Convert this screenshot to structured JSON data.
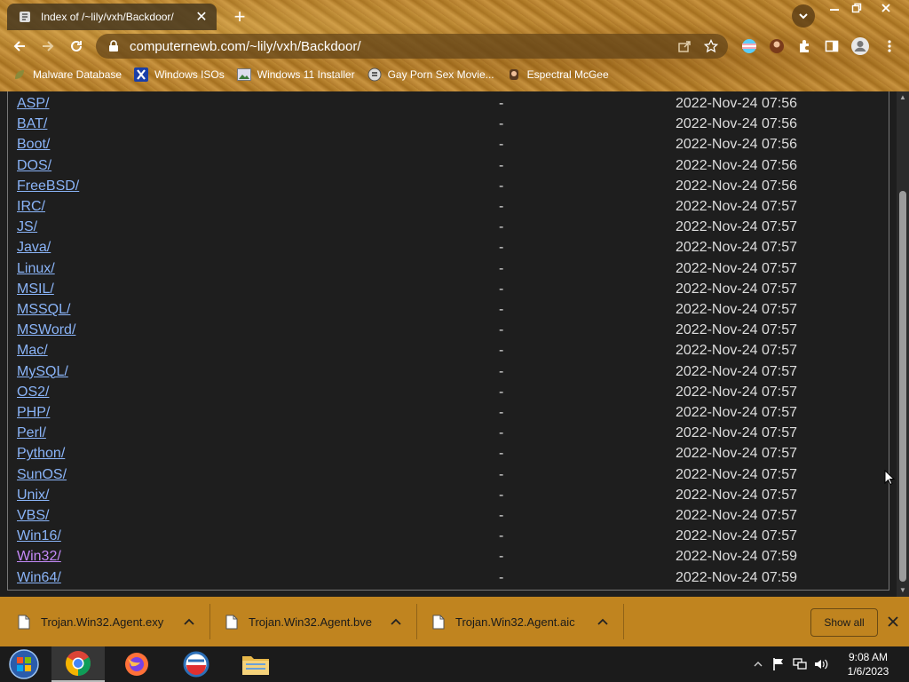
{
  "browser": {
    "tab": {
      "title": "Index of /~lily/vxh/Backdoor/"
    },
    "address": {
      "url": "computernewb.com/~lily/vxh/Backdoor/"
    },
    "bookmarks": [
      {
        "label": "Malware Database",
        "icon": "leaf-icon"
      },
      {
        "label": "Windows ISOs",
        "icon": "x-logo-icon"
      },
      {
        "label": "Windows 11 Installer",
        "icon": "image-icon"
      },
      {
        "label": "Gay Porn Sex Movie...",
        "icon": "badge-icon"
      },
      {
        "label": "Espectral McGee",
        "icon": "character-icon"
      }
    ]
  },
  "listing": {
    "rows": [
      {
        "name": "ASP/",
        "size": "-",
        "date": "2022-Nov-24 07:56"
      },
      {
        "name": "BAT/",
        "size": "-",
        "date": "2022-Nov-24 07:56"
      },
      {
        "name": "Boot/",
        "size": "-",
        "date": "2022-Nov-24 07:56"
      },
      {
        "name": "DOS/",
        "size": "-",
        "date": "2022-Nov-24 07:56"
      },
      {
        "name": "FreeBSD/",
        "size": "-",
        "date": "2022-Nov-24 07:56"
      },
      {
        "name": "IRC/",
        "size": "-",
        "date": "2022-Nov-24 07:57"
      },
      {
        "name": "JS/",
        "size": "-",
        "date": "2022-Nov-24 07:57"
      },
      {
        "name": "Java/",
        "size": "-",
        "date": "2022-Nov-24 07:57"
      },
      {
        "name": "Linux/",
        "size": "-",
        "date": "2022-Nov-24 07:57"
      },
      {
        "name": "MSIL/",
        "size": "-",
        "date": "2022-Nov-24 07:57"
      },
      {
        "name": "MSSQL/",
        "size": "-",
        "date": "2022-Nov-24 07:57"
      },
      {
        "name": "MSWord/",
        "size": "-",
        "date": "2022-Nov-24 07:57"
      },
      {
        "name": "Mac/",
        "size": "-",
        "date": "2022-Nov-24 07:57"
      },
      {
        "name": "MySQL/",
        "size": "-",
        "date": "2022-Nov-24 07:57"
      },
      {
        "name": "OS2/",
        "size": "-",
        "date": "2022-Nov-24 07:57"
      },
      {
        "name": "PHP/",
        "size": "-",
        "date": "2022-Nov-24 07:57"
      },
      {
        "name": "Perl/",
        "size": "-",
        "date": "2022-Nov-24 07:57"
      },
      {
        "name": "Python/",
        "size": "-",
        "date": "2022-Nov-24 07:57"
      },
      {
        "name": "SunOS/",
        "size": "-",
        "date": "2022-Nov-24 07:57"
      },
      {
        "name": "Unix/",
        "size": "-",
        "date": "2022-Nov-24 07:57"
      },
      {
        "name": "VBS/",
        "size": "-",
        "date": "2022-Nov-24 07:57"
      },
      {
        "name": "Win16/",
        "size": "-",
        "date": "2022-Nov-24 07:57"
      },
      {
        "name": "Win32/",
        "size": "-",
        "date": "2022-Nov-24 07:59",
        "visited": true
      },
      {
        "name": "Win64/",
        "size": "-",
        "date": "2022-Nov-24 07:59"
      }
    ]
  },
  "downloads": {
    "items": [
      {
        "name": "Trojan.Win32.Agent.exy"
      },
      {
        "name": "Trojan.Win32.Agent.bve"
      },
      {
        "name": "Trojan.Win32.Agent.aic"
      }
    ],
    "show_all_label": "Show all"
  },
  "taskbar": {
    "apps": [
      "start-orb-icon",
      "chrome-icon",
      "firefox-icon",
      "opera-icon",
      "file-explorer-icon"
    ],
    "clock": {
      "time": "9:08 AM",
      "date": "1/6/2023"
    }
  },
  "colors": {
    "link": "#8ab4f8",
    "visited_link": "#c58af9",
    "page_background": "#1e1e1e",
    "download_bar": "#c0841f"
  }
}
